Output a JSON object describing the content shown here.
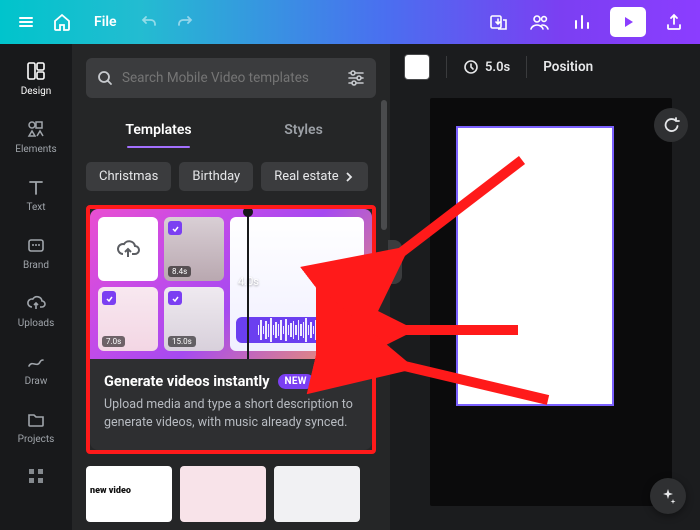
{
  "topbar": {
    "file_label": "File"
  },
  "rail": {
    "items": [
      {
        "label": "Design"
      },
      {
        "label": "Elements"
      },
      {
        "label": "Text"
      },
      {
        "label": "Brand"
      },
      {
        "label": "Uploads"
      },
      {
        "label": "Draw"
      },
      {
        "label": "Projects"
      }
    ]
  },
  "search": {
    "placeholder": "Search Mobile Video templates"
  },
  "tabs": {
    "templates": "Templates",
    "styles": "Styles"
  },
  "chips": [
    "Christmas",
    "Birthday",
    "Real estate"
  ],
  "card": {
    "title": "Generate videos instantly",
    "badge": "NEW",
    "desc": "Upload media and type a short description to generate videos, with music already synced.",
    "big_tile_duration": "4.0s",
    "small_durations": {
      "dog1": "8.4s",
      "dog2": "7.0s",
      "dog3": "15.0s"
    }
  },
  "canvas": {
    "duration": "5.0s",
    "position_label": "Position"
  }
}
